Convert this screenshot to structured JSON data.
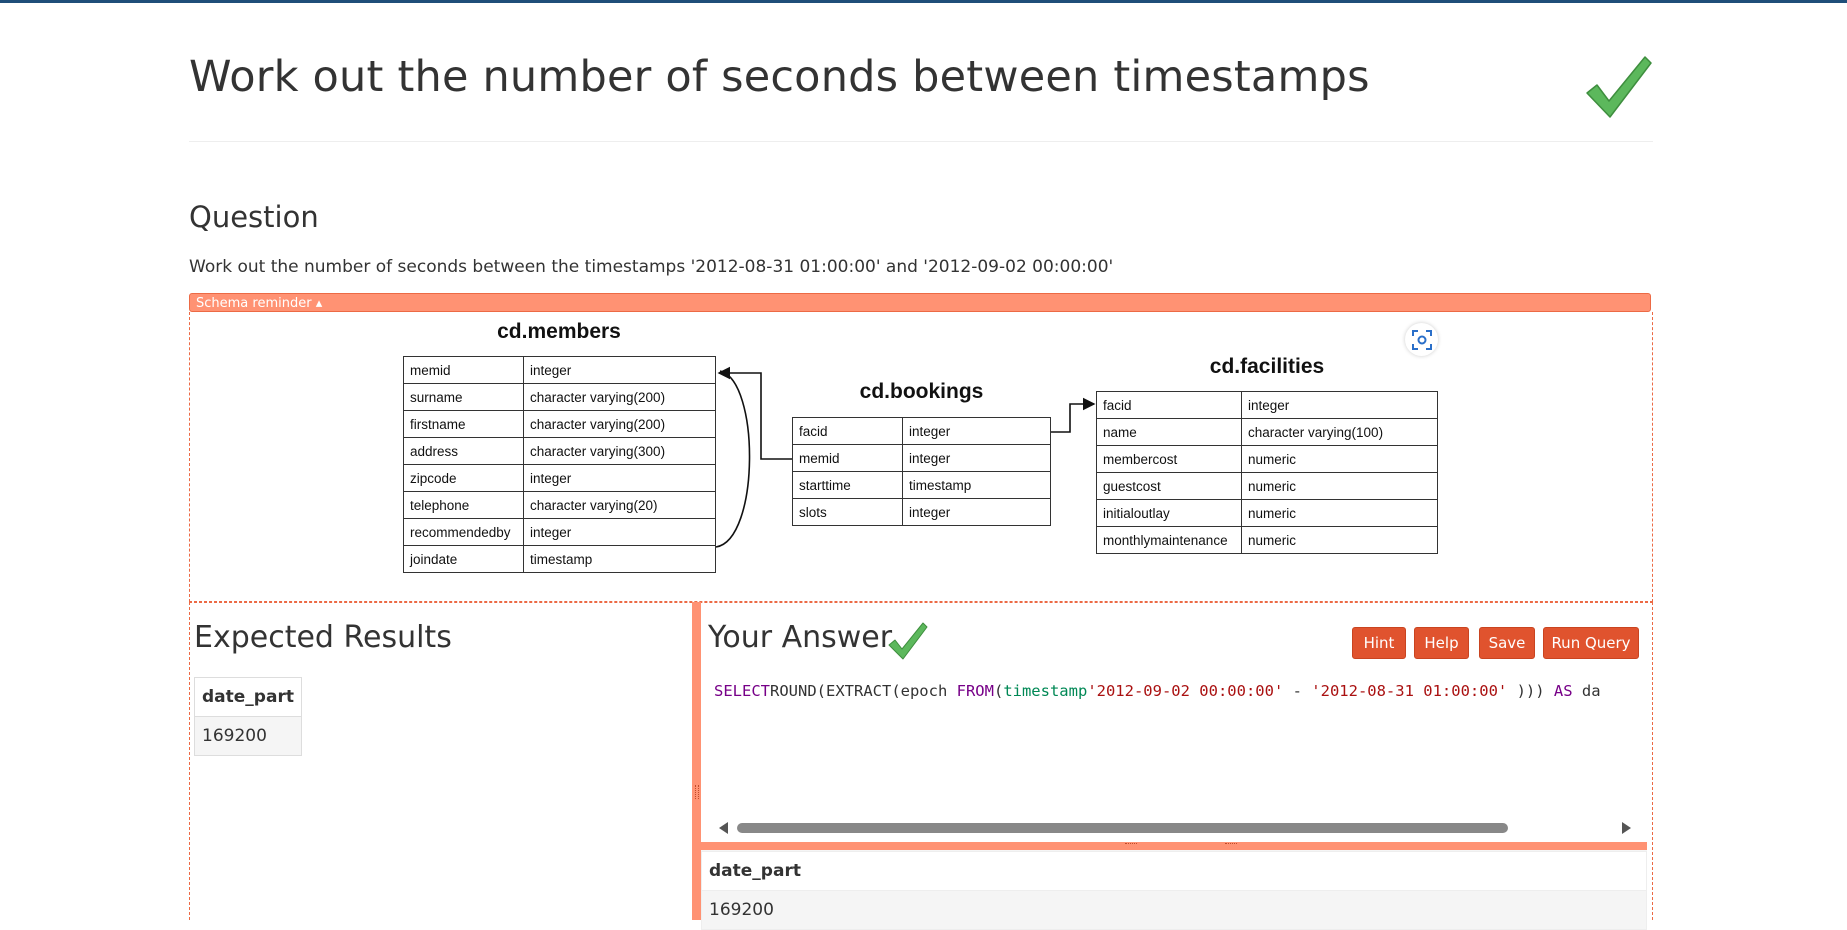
{
  "page": {
    "title": "Work out the number of seconds between timestamps"
  },
  "question": {
    "heading": "Question",
    "text": "Work out the number of seconds between the timestamps '2012-08-31 01:00:00' and '2012-09-02 00:00:00'"
  },
  "schema": {
    "toggle_label": "Schema reminder ▴",
    "tables": [
      {
        "name": "cd.members",
        "columns": [
          [
            "memid",
            "integer"
          ],
          [
            "surname",
            "character varying(200)"
          ],
          [
            "firstname",
            "character varying(200)"
          ],
          [
            "address",
            "character varying(300)"
          ],
          [
            "zipcode",
            "integer"
          ],
          [
            "telephone",
            "character varying(20)"
          ],
          [
            "recommendedby",
            "integer"
          ],
          [
            "joindate",
            "timestamp"
          ]
        ]
      },
      {
        "name": "cd.bookings",
        "columns": [
          [
            "facid",
            "integer"
          ],
          [
            "memid",
            "integer"
          ],
          [
            "starttime",
            "timestamp"
          ],
          [
            "slots",
            "integer"
          ]
        ]
      },
      {
        "name": "cd.facilities",
        "columns": [
          [
            "facid",
            "integer"
          ],
          [
            "name",
            "character varying(100)"
          ],
          [
            "membercost",
            "numeric"
          ],
          [
            "guestcost",
            "numeric"
          ],
          [
            "initialoutlay",
            "numeric"
          ],
          [
            "monthlymaintenance",
            "numeric"
          ]
        ]
      }
    ]
  },
  "expected": {
    "heading": "Expected Results",
    "column": "date_part",
    "value": "169200"
  },
  "answer": {
    "heading": "Your Answer",
    "buttons": {
      "hint": "Hint",
      "help": "Help",
      "save": "Save",
      "run": "Run Query"
    },
    "code_tokens": [
      [
        "kw",
        "SELECT"
      ],
      [
        "",
        "ROUND(EXTRACT(epoch "
      ],
      [
        "kw",
        "FROM"
      ],
      [
        "",
        "("
      ],
      [
        "ty",
        "timestamp"
      ],
      [
        "",
        ""
      ],
      [
        "st",
        "'2012-09-02 00:00:00'"
      ],
      [
        "",
        " - "
      ],
      [
        "st",
        "'2012-08-31 01:00:00'"
      ],
      [
        "",
        " ))) "
      ],
      [
        "kw",
        "AS"
      ],
      [
        "",
        " da"
      ]
    ],
    "result_column": "date_part",
    "result_value": "169200"
  },
  "colors": {
    "accent": "#ff9273",
    "button": "#e0532e",
    "check": "#5cb85c",
    "topbar": "#1f4e79"
  },
  "icons": [
    "checkmark-icon",
    "focus-zoom-icon"
  ]
}
